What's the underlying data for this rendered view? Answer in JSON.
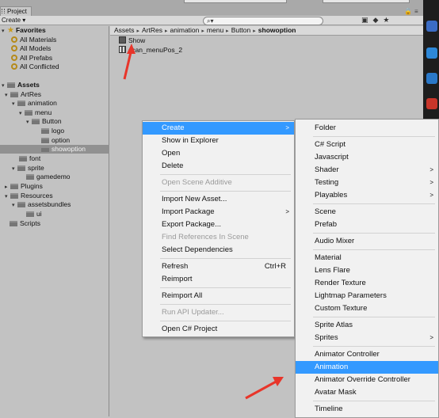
{
  "window": {
    "tab_label": "Project"
  },
  "toolbar": {
    "create_label": "Create ▾",
    "search_placeholder": ""
  },
  "favorites": {
    "header": "Favorites",
    "items": [
      "All Materials",
      "All Models",
      "All Prefabs",
      "All Conflicted"
    ]
  },
  "tree": {
    "assets": "Assets",
    "artres": "ArtRes",
    "animation": "animation",
    "menu": "menu",
    "button": "Button",
    "logo": "logo",
    "option": "option",
    "showoption": "showoption",
    "font": "font",
    "sprite": "sprite",
    "gamedemo": "gamedemo",
    "plugins": "Plugins",
    "resources": "Resources",
    "assetsbundles": "assetsbundles",
    "ui": "ui",
    "scripts": "Scripts"
  },
  "breadcrumb": [
    "Assets",
    "ArtRes",
    "animation",
    "menu",
    "Button",
    "showoption"
  ],
  "assets": [
    "Show",
    "scan_menuPos_2"
  ],
  "context_menu": {
    "items": [
      {
        "label": "Create",
        "submenu": true,
        "highlighted": true
      },
      {
        "label": "Show in Explorer"
      },
      {
        "label": "Open"
      },
      {
        "label": "Delete"
      },
      {
        "label": "Open Scene Additive",
        "disabled": true
      },
      {
        "label": "Import New Asset..."
      },
      {
        "label": "Import Package",
        "submenu": true
      },
      {
        "label": "Export Package..."
      },
      {
        "label": "Find References In Scene",
        "disabled": true
      },
      {
        "label": "Select Dependencies"
      },
      {
        "label": "Refresh",
        "shortcut": "Ctrl+R"
      },
      {
        "label": "Reimport"
      },
      {
        "label": "Reimport All"
      },
      {
        "label": "Run API Updater...",
        "disabled": true
      },
      {
        "label": "Open C# Project"
      }
    ]
  },
  "create_submenu": {
    "items": [
      {
        "label": "Folder"
      },
      {
        "label": "C# Script"
      },
      {
        "label": "Javascript"
      },
      {
        "label": "Shader",
        "submenu": true
      },
      {
        "label": "Testing",
        "submenu": true
      },
      {
        "label": "Playables",
        "submenu": true
      },
      {
        "label": "Scene"
      },
      {
        "label": "Prefab"
      },
      {
        "label": "Audio Mixer"
      },
      {
        "label": "Material"
      },
      {
        "label": "Lens Flare"
      },
      {
        "label": "Render Texture"
      },
      {
        "label": "Lightmap Parameters"
      },
      {
        "label": "Custom Texture"
      },
      {
        "label": "Sprite Atlas"
      },
      {
        "label": "Sprites",
        "submenu": true
      },
      {
        "label": "Animator Controller"
      },
      {
        "label": "Animation",
        "highlighted": true
      },
      {
        "label": "Animator Override Controller"
      },
      {
        "label": "Avatar Mask"
      },
      {
        "label": "Timeline"
      }
    ]
  },
  "colors": {
    "highlight": "#3399ff",
    "annotation_arrow": "#e8352a"
  }
}
